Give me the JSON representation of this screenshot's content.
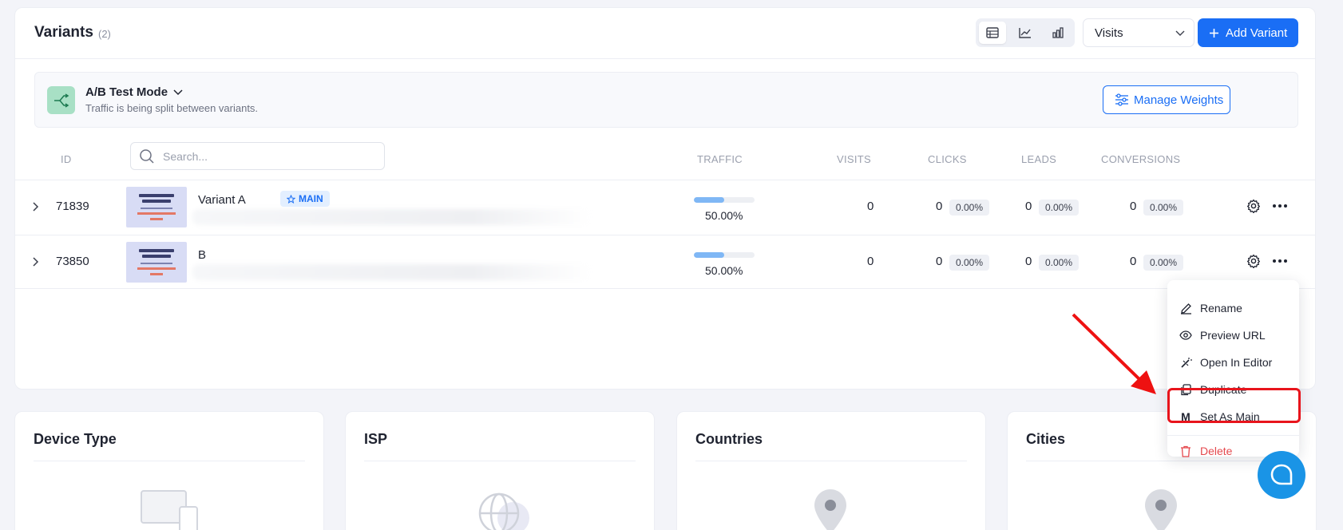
{
  "header": {
    "title": "Variants",
    "count": "(2)",
    "view_toggle": [
      "table-icon",
      "line-chart-icon",
      "bar-chart-icon"
    ],
    "metric_select": "Visits",
    "add_button": "Add Variant"
  },
  "ab_mode": {
    "title": "A/B Test Mode",
    "subtitle": "Traffic is being split between variants.",
    "manage_button": "Manage Weights"
  },
  "table": {
    "headers": {
      "id": "ID",
      "traffic": "TRAFFIC",
      "visits": "VISITS",
      "clicks": "CLICKS",
      "leads": "LEADS",
      "conversions": "CONVERSIONS"
    },
    "search_placeholder": "Search...",
    "rows": [
      {
        "id": "71839",
        "name": "Variant A",
        "badge": "MAIN",
        "traffic_fraction": 0.5,
        "traffic": "50.00%",
        "visits": "0",
        "clicks": "0",
        "clicks_pct": "0.00%",
        "leads": "0",
        "leads_pct": "0.00%",
        "conversions": "0",
        "conversions_pct": "0.00%"
      },
      {
        "id": "73850",
        "name": "B",
        "traffic_fraction": 0.5,
        "traffic": "50.00%",
        "visits": "0",
        "clicks": "0",
        "clicks_pct": "0.00%",
        "leads": "0",
        "leads_pct": "0.00%",
        "conversions": "0",
        "conversions_pct": "0.00%"
      }
    ]
  },
  "context_menu": {
    "items": [
      "Rename",
      "Preview URL",
      "Open In Editor",
      "Duplicate",
      "Set As Main",
      "Delete"
    ],
    "highlighted": "Set As Main"
  },
  "stats": {
    "device_type": "Device Type",
    "isp": "ISP",
    "countries": "Countries",
    "cities": "Cities"
  },
  "colors": {
    "primary": "#1a6ef5",
    "danger": "#e5484d",
    "highlight": "#e8141c",
    "ab_icon_bg": "#a8e0c5",
    "chat": "#1a94e6"
  }
}
